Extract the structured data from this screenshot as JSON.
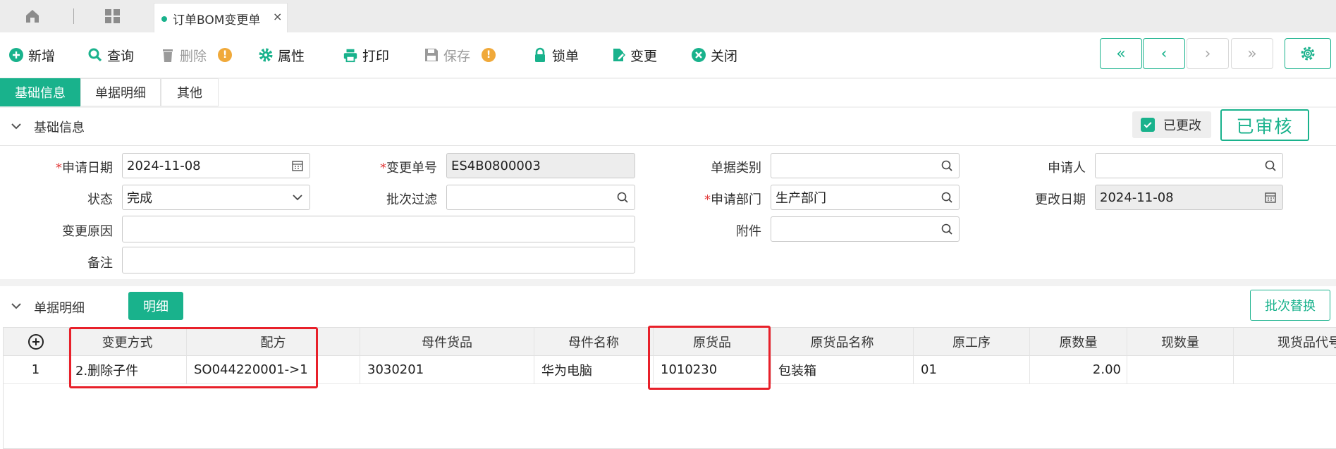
{
  "tabs": {
    "active_label": "订单BOM变更单",
    "close": "×"
  },
  "toolbar": {
    "add": "新增",
    "query": "查询",
    "delete": "删除",
    "properties": "属性",
    "print": "打印",
    "save": "保存",
    "lock": "锁单",
    "change": "变更",
    "close": "关闭",
    "warn": "!",
    "nav_first": "«",
    "nav_prev": "‹",
    "nav_next": "›",
    "nav_last": "»"
  },
  "page_tabs": [
    "基础信息",
    "单据明细",
    "其他"
  ],
  "basic": {
    "section_title": "基础信息",
    "changed_label": "已更改",
    "stamp": "已审核",
    "fields": {
      "apply_date_label": "申请日期",
      "apply_date": "2024-11-08",
      "change_no_label": "变更单号",
      "change_no": "ES4B0800003",
      "doc_type_label": "单据类别",
      "doc_type": "",
      "applicant_label": "申请人",
      "applicant": "",
      "status_label": "状态",
      "status": "完成",
      "batch_filter_label": "批次过滤",
      "batch_filter": "",
      "dept_label": "申请部门",
      "dept": "生产部门",
      "modify_date_label": "更改日期",
      "modify_date": "2024-11-08",
      "reason_label": "变更原因",
      "reason": "",
      "attachment_label": "附件",
      "attachment": "",
      "remark_label": "备注",
      "remark": "",
      "required_mark": "*"
    }
  },
  "detail": {
    "section_title": "单据明细",
    "detail_button": "明细",
    "batch_replace_button": "批次替换",
    "add_row": "+",
    "columns": [
      "变更方式",
      "配方",
      "母件货品",
      "母件名称",
      "原货品",
      "原货品名称",
      "原工序",
      "原数量",
      "现数量",
      "现货品代号"
    ],
    "rows": [
      {
        "no": "1",
        "method": "2.删除子件",
        "formula": "SO044220001->1",
        "parent_item": "3030201",
        "parent_name": "华为电脑",
        "orig_item": "1010230",
        "orig_item_name": "包装箱",
        "orig_process": "01",
        "orig_qty": "2.00",
        "new_qty": "",
        "new_item_code": ""
      }
    ]
  },
  "colors": {
    "accent": "#19b28c",
    "highlight": "#e8202a",
    "warning": "#f0a93a"
  }
}
